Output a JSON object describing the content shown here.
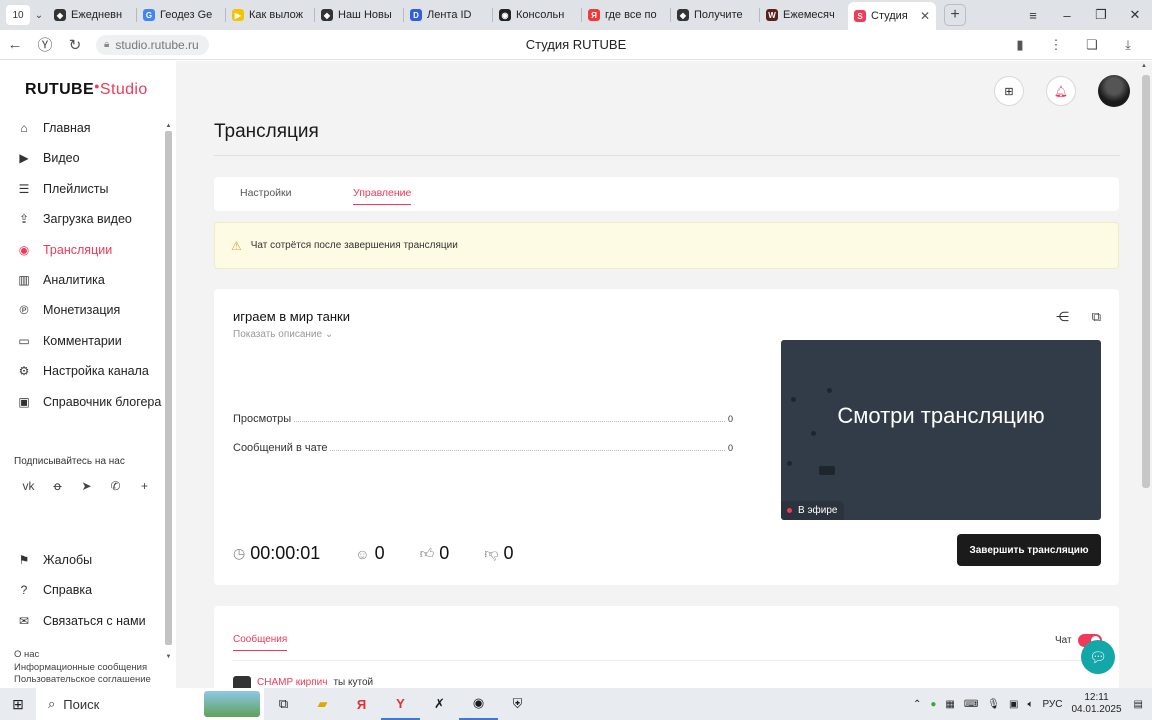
{
  "browser": {
    "tab_count": "10",
    "tabs": [
      {
        "title": "Ежедневн",
        "fav_color": "#333333",
        "fav_glyph": "◆"
      },
      {
        "title": "Геодез Ge",
        "fav_color": "#4285f4",
        "fav_glyph": "G"
      },
      {
        "title": "Как вылож",
        "fav_color": "#f5c400",
        "fav_glyph": "▶"
      },
      {
        "title": "Наш Новы",
        "fav_color": "#333333",
        "fav_glyph": "◆"
      },
      {
        "title": "Лента ID",
        "fav_color": "#2f5fe0",
        "fav_glyph": "D"
      },
      {
        "title": "Консольн",
        "fav_color": "#222222",
        "fav_glyph": "◉"
      },
      {
        "title": "где все по",
        "fav_color": "#f03a3a",
        "fav_glyph": "Я"
      },
      {
        "title": "Получите",
        "fav_color": "#333333",
        "fav_glyph": "◆"
      },
      {
        "title": "Ежемесяч",
        "fav_color": "#5a1f1f",
        "fav_glyph": "W"
      },
      {
        "title": "Студия",
        "fav_color": "#f03a58",
        "fav_glyph": "S"
      }
    ],
    "url": "studio.rutube.ru",
    "page_title": "Студия RUTUBE"
  },
  "sidebar": {
    "logo_main": "RUTUBE",
    "logo_sub": "Studio",
    "items": [
      {
        "label": "Главная",
        "icon": "home-icon",
        "glyph": "⌂"
      },
      {
        "label": "Видео",
        "icon": "video-icon",
        "glyph": "▶"
      },
      {
        "label": "Плейлисты",
        "icon": "playlist-icon",
        "glyph": "☰"
      },
      {
        "label": "Загрузка видео",
        "icon": "upload-icon",
        "glyph": "⇪"
      },
      {
        "label": "Трансляции",
        "icon": "broadcast-icon",
        "glyph": "◉"
      },
      {
        "label": "Аналитика",
        "icon": "analytics-icon",
        "glyph": "▥"
      },
      {
        "label": "Монетизация",
        "icon": "monetization-icon",
        "glyph": "℗"
      },
      {
        "label": "Комментарии",
        "icon": "comments-icon",
        "glyph": "▭"
      },
      {
        "label": "Настройка канала",
        "icon": "settings-icon",
        "glyph": "⚙"
      },
      {
        "label": "Справочник блогера",
        "icon": "guide-icon",
        "glyph": "▣"
      }
    ],
    "active_index": 4,
    "subscribe_label": "Подписывайтесь на нас",
    "social": [
      "vk-icon",
      "ok-icon",
      "telegram-icon",
      "viber-icon",
      "plus-icon"
    ],
    "bottom_items": [
      {
        "label": "Жалобы",
        "icon": "flag-icon",
        "glyph": "⚑"
      },
      {
        "label": "Справка",
        "icon": "help-icon",
        "glyph": "?"
      },
      {
        "label": "Связаться с нами",
        "icon": "mail-icon",
        "glyph": "✉"
      }
    ],
    "footer_links": [
      "О нас",
      "Информационные сообщения",
      "Пользовательское соглашение"
    ]
  },
  "main": {
    "page_title": "Трансляция",
    "tabs": [
      "Настройки",
      "Управление"
    ],
    "active_tab": 1,
    "notice": "Чат сотрётся после завершения трансляции",
    "stream": {
      "title": "играем в мир танки",
      "show_description": "Показать описание",
      "stats": [
        {
          "label": "Просмотры",
          "value": "0"
        },
        {
          "label": "Сообщений в чате",
          "value": "0"
        }
      ],
      "preview_text": "Смотри трансляцию",
      "live_label": "В эфире",
      "duration": "00:00:01",
      "viewers": "0",
      "likes": "0",
      "dislikes": "0",
      "end_button": "Завершить трансляцию"
    },
    "chat": {
      "tab": "Сообщения",
      "toggle_label": "Чат",
      "toggle_on": true,
      "messages": [
        {
          "user": "CHAMP кирпич",
          "text": "ты кутой"
        }
      ]
    }
  },
  "taskbar": {
    "search_placeholder": "Поиск",
    "lang": "РУС",
    "time": "12:11",
    "date": "04.01.2025"
  }
}
